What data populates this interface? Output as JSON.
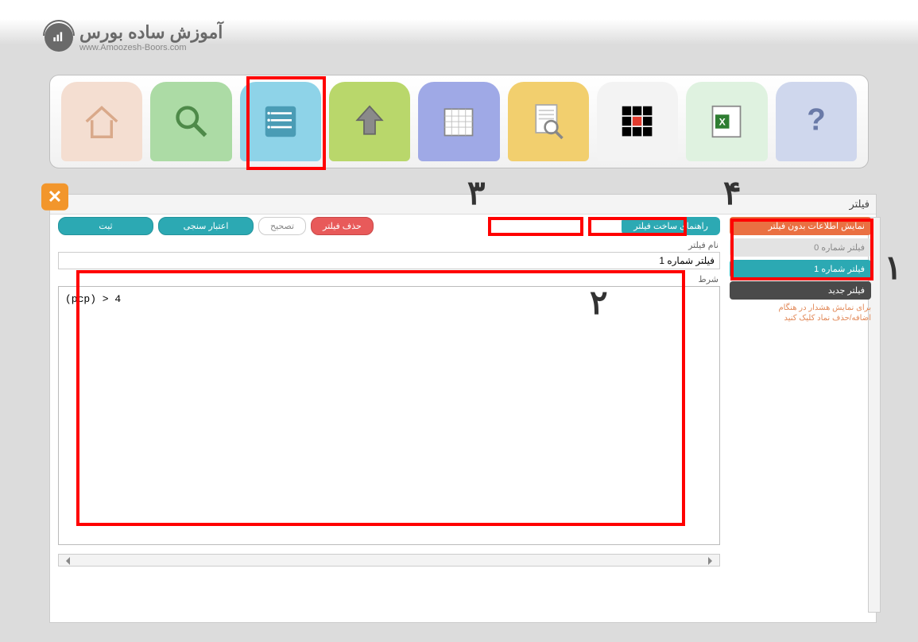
{
  "logo": {
    "title_ar": "آموزش ساده بورس",
    "title_en": "www.Amoozesh-Boors.com"
  },
  "toolbar": {
    "items": [
      {
        "name": "home-icon",
        "color": "c-home"
      },
      {
        "name": "search-icon",
        "color": "c-search"
      },
      {
        "name": "list-icon",
        "color": "c-list"
      },
      {
        "name": "upload-icon",
        "color": "c-up"
      },
      {
        "name": "calendar-icon",
        "color": "c-cal"
      },
      {
        "name": "doc-search-icon",
        "color": "c-doc"
      },
      {
        "name": "grid-icon",
        "color": "c-grid"
      },
      {
        "name": "excel-icon",
        "color": "c-excel"
      },
      {
        "name": "help-icon",
        "color": "c-help"
      }
    ]
  },
  "annotations": {
    "n1": "۱",
    "n2": "۲",
    "n3": "۳",
    "n4": "۴"
  },
  "filter": {
    "window_title": "فیلتر",
    "sidebar": {
      "show_no_filter": "نمایش اطلاعات بدون فیلتر",
      "items": [
        {
          "label": "فیلتر شماره 0",
          "style": "pill-gray"
        },
        {
          "label": "فیلتر شماره 1",
          "style": "pill-teal"
        },
        {
          "label": "فیلتر جدید",
          "style": "pill-dark"
        }
      ],
      "hint_l1": "برای نمایش هشدار در هنگام",
      "hint_l2": "اضافه/حذف نماد کلیک کنید"
    },
    "buttons": {
      "save": "ثبت",
      "validate": "اعتبار سنجی",
      "correct": "تصحیح",
      "delete": "حذف فیلتر",
      "guide": "راهنمای ساخت فیلتر"
    },
    "labels": {
      "filter_name": "نام فیلتر",
      "condition": "شرط"
    },
    "values": {
      "filter_name": "فیلتر شماره 1",
      "editor": "(pcp) > 4"
    }
  }
}
